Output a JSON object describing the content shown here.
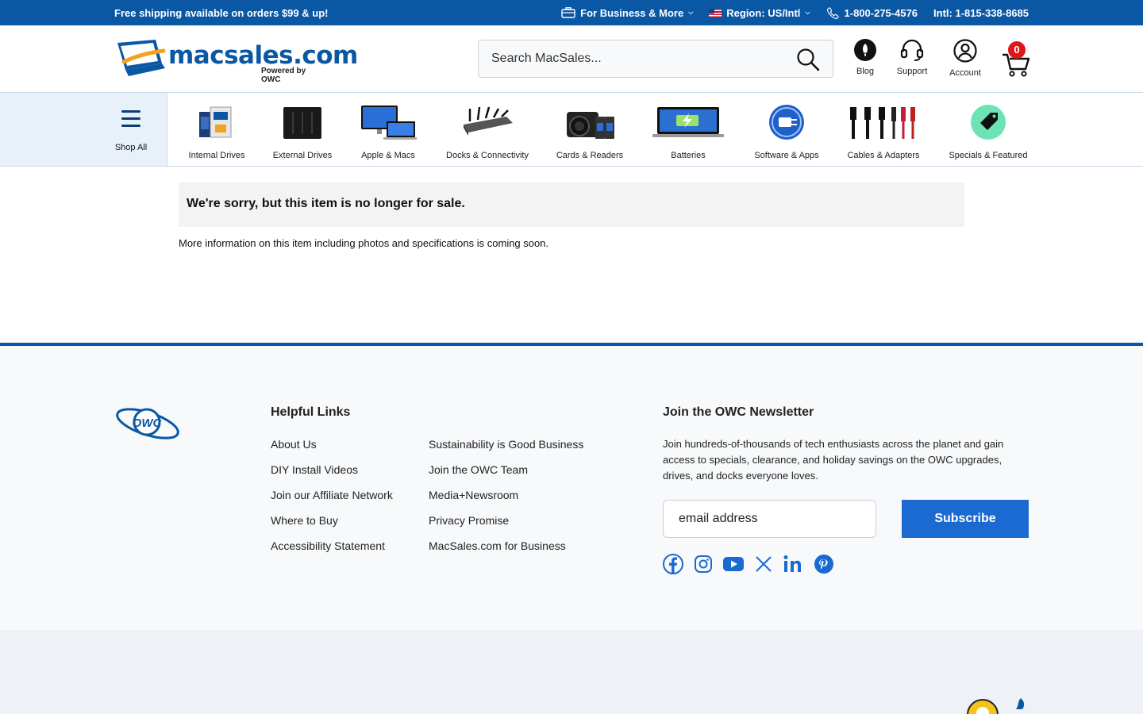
{
  "topbar": {
    "promo": "Free shipping available on orders $99 & up!",
    "business": "For Business & More",
    "region": "Region: US/Intl",
    "phone": "1-800-275-4576",
    "intl": "Intl: 1-815-338-8685"
  },
  "header": {
    "logo_word": "macsales.com",
    "logo_sub": "Powered by OWC",
    "search_placeholder": "Search MacSales...",
    "blog": "Blog",
    "support": "Support",
    "account": "Account",
    "cart_count": "0"
  },
  "catnav": {
    "shop_all": "Shop All",
    "items": [
      {
        "label": "Internal Drives"
      },
      {
        "label": "External Drives"
      },
      {
        "label": "Apple & Macs"
      },
      {
        "label": "Docks & Connectivity"
      },
      {
        "label": "Cards & Readers"
      },
      {
        "label": "Batteries"
      },
      {
        "label": "Software & Apps"
      },
      {
        "label": "Cables & Adapters"
      },
      {
        "label": "Specials & Featured"
      }
    ]
  },
  "main": {
    "notice": "We're sorry, but this item is no longer for sale.",
    "more_info": "More information on this item including photos and specifications is coming soon."
  },
  "footer": {
    "logo_text": "OWC",
    "helpful_title": "Helpful Links",
    "links_col1": [
      "About Us",
      "DIY Install Videos",
      "Join our Affiliate Network",
      "Where to Buy",
      "Accessibility Statement"
    ],
    "links_col2": [
      "Sustainability is Good Business",
      "Join the OWC Team",
      "Media+Newsroom",
      "Privacy Promise",
      "MacSales.com for Business"
    ],
    "newsletter_title": "Join the OWC Newsletter",
    "newsletter_text": "Join hundreds-of-thousands of tech enthusiasts across the planet and gain access to specials, clearance, and holiday savings on the OWC upgrades, drives, and docks everyone loves.",
    "email_placeholder": "email address",
    "subscribe": "Subscribe",
    "social": [
      "facebook-icon",
      "instagram-icon",
      "youtube-icon",
      "x-icon",
      "linkedin-icon",
      "pinterest-icon"
    ]
  },
  "colors": {
    "brand_blue": "#0a57a4",
    "subscribe_blue": "#1b6ad1",
    "cart_badge": "#e0161d",
    "specials_green": "#6be3b5"
  }
}
